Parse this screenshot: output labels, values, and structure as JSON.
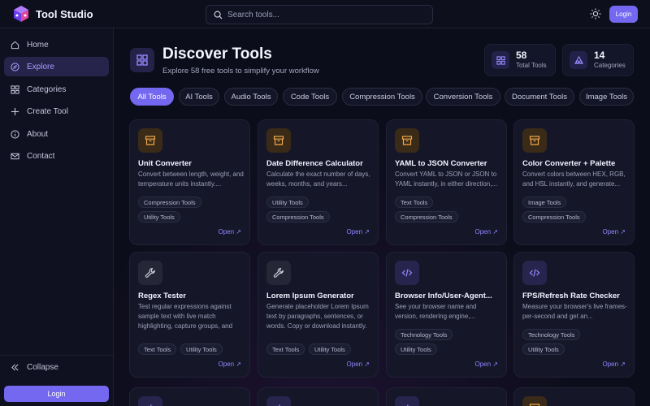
{
  "app": {
    "name": "Tool Studio",
    "search_placeholder": "Search tools...",
    "login_label": "Login"
  },
  "sidebar": {
    "items": [
      {
        "label": "Home",
        "icon": "home-icon",
        "active": false
      },
      {
        "label": "Explore",
        "icon": "compass-icon",
        "active": true
      },
      {
        "label": "Categories",
        "icon": "grid-icon",
        "active": false
      },
      {
        "label": "Create Tool",
        "icon": "plus-icon",
        "active": false
      },
      {
        "label": "About",
        "icon": "info-icon",
        "active": false
      },
      {
        "label": "Contact",
        "icon": "mail-icon",
        "active": false
      }
    ],
    "collapse_label": "Collapse",
    "login_label": "Login"
  },
  "hero": {
    "title": "Discover Tools",
    "subtitle": "Explore 58 free tools to simplify your workflow"
  },
  "stats": [
    {
      "value": "58",
      "label": "Total Tools",
      "icon": "grid-icon"
    },
    {
      "value": "14",
      "label": "Categories",
      "icon": "shapes-icon"
    }
  ],
  "tabs": [
    {
      "label": "All Tools",
      "active": true
    },
    {
      "label": "AI Tools",
      "active": false
    },
    {
      "label": "Audio Tools",
      "active": false
    },
    {
      "label": "Code Tools",
      "active": false
    },
    {
      "label": "Compression Tools",
      "active": false
    },
    {
      "label": "Conversion Tools",
      "active": false
    },
    {
      "label": "Document Tools",
      "active": false
    },
    {
      "label": "Image Tools",
      "active": false
    }
  ],
  "cards": [
    {
      "title": "Unit Converter",
      "description": "Convert between length, weight, and temperature units instantly....",
      "tags": [
        "Compression Tools",
        "Utility Tools"
      ],
      "icon": "archive-icon",
      "open_label": "Open"
    },
    {
      "title": "Date Difference Calculator",
      "description": "Calculate the exact number of days, weeks, months, and years...",
      "tags": [
        "Utility Tools",
        "Compression Tools"
      ],
      "icon": "archive-icon",
      "open_label": "Open"
    },
    {
      "title": "YAML to JSON Converter",
      "description": "Convert YAML to JSON or JSON to YAML instantly, in either direction,...",
      "tags": [
        "Text Tools",
        "Compression Tools"
      ],
      "icon": "archive-icon",
      "open_label": "Open"
    },
    {
      "title": "Color Converter + Palette",
      "description": "Convert colors between HEX, RGB, and HSL instantly, and generate...",
      "tags": [
        "Image Tools",
        "Compression Tools"
      ],
      "icon": "archive-icon",
      "open_label": "Open"
    },
    {
      "title": "Regex Tester",
      "description": "Test regular expressions against sample text with live match highlighting, capture groups, and flag support (g/i/m/s). All",
      "tags": [
        "Text Tools",
        "Utility Tools"
      ],
      "icon": "wrench-icon",
      "open_label": "Open"
    },
    {
      "title": "Lorem Ipsum Generator",
      "description": "Generate placeholder Lorem Ipsum text by paragraphs, sentences, or words. Copy or download instantly. All generation happens in your",
      "tags": [
        "Text Tools",
        "Utility Tools"
      ],
      "icon": "wrench-icon",
      "open_label": "Open"
    },
    {
      "title": "Browser Info/User-Agent...",
      "description": "See your browser name and version, rendering engine,...",
      "tags": [
        "Technology Tools",
        "Utility Tools"
      ],
      "icon": "code-icon",
      "open_label": "Open"
    },
    {
      "title": "FPS/Refresh Rate Checker",
      "description": "Measure your browser's live frames-per-second and get an...",
      "tags": [
        "Technology Tools",
        "Utility Tools"
      ],
      "icon": "code-icon",
      "open_label": "Open"
    }
  ],
  "colors": {
    "accent": "#7467f0",
    "background": "#0c0d1a",
    "card": "#151728",
    "archive_icon_bg": "#3a2a18",
    "archive_icon": "#f0a94a",
    "code_icon_bg": "#27244e",
    "code_icon": "#9b8cff",
    "wrench_icon_bg": "#252737"
  }
}
